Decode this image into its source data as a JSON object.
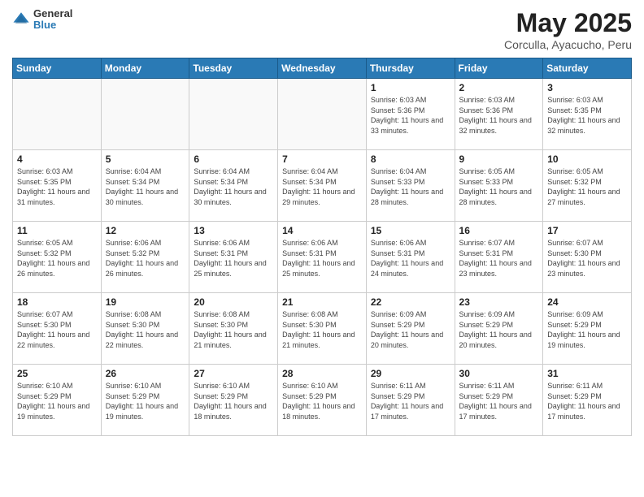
{
  "header": {
    "logo_line1": "General",
    "logo_line2": "Blue",
    "month_title": "May 2025",
    "subtitle": "Corculla, Ayacucho, Peru"
  },
  "weekdays": [
    "Sunday",
    "Monday",
    "Tuesday",
    "Wednesday",
    "Thursday",
    "Friday",
    "Saturday"
  ],
  "weeks": [
    [
      {
        "day": "",
        "info": ""
      },
      {
        "day": "",
        "info": ""
      },
      {
        "day": "",
        "info": ""
      },
      {
        "day": "",
        "info": ""
      },
      {
        "day": "1",
        "info": "Sunrise: 6:03 AM\nSunset: 5:36 PM\nDaylight: 11 hours and 33 minutes."
      },
      {
        "day": "2",
        "info": "Sunrise: 6:03 AM\nSunset: 5:36 PM\nDaylight: 11 hours and 32 minutes."
      },
      {
        "day": "3",
        "info": "Sunrise: 6:03 AM\nSunset: 5:35 PM\nDaylight: 11 hours and 32 minutes."
      }
    ],
    [
      {
        "day": "4",
        "info": "Sunrise: 6:03 AM\nSunset: 5:35 PM\nDaylight: 11 hours and 31 minutes."
      },
      {
        "day": "5",
        "info": "Sunrise: 6:04 AM\nSunset: 5:34 PM\nDaylight: 11 hours and 30 minutes."
      },
      {
        "day": "6",
        "info": "Sunrise: 6:04 AM\nSunset: 5:34 PM\nDaylight: 11 hours and 30 minutes."
      },
      {
        "day": "7",
        "info": "Sunrise: 6:04 AM\nSunset: 5:34 PM\nDaylight: 11 hours and 29 minutes."
      },
      {
        "day": "8",
        "info": "Sunrise: 6:04 AM\nSunset: 5:33 PM\nDaylight: 11 hours and 28 minutes."
      },
      {
        "day": "9",
        "info": "Sunrise: 6:05 AM\nSunset: 5:33 PM\nDaylight: 11 hours and 28 minutes."
      },
      {
        "day": "10",
        "info": "Sunrise: 6:05 AM\nSunset: 5:32 PM\nDaylight: 11 hours and 27 minutes."
      }
    ],
    [
      {
        "day": "11",
        "info": "Sunrise: 6:05 AM\nSunset: 5:32 PM\nDaylight: 11 hours and 26 minutes."
      },
      {
        "day": "12",
        "info": "Sunrise: 6:06 AM\nSunset: 5:32 PM\nDaylight: 11 hours and 26 minutes."
      },
      {
        "day": "13",
        "info": "Sunrise: 6:06 AM\nSunset: 5:31 PM\nDaylight: 11 hours and 25 minutes."
      },
      {
        "day": "14",
        "info": "Sunrise: 6:06 AM\nSunset: 5:31 PM\nDaylight: 11 hours and 25 minutes."
      },
      {
        "day": "15",
        "info": "Sunrise: 6:06 AM\nSunset: 5:31 PM\nDaylight: 11 hours and 24 minutes."
      },
      {
        "day": "16",
        "info": "Sunrise: 6:07 AM\nSunset: 5:31 PM\nDaylight: 11 hours and 23 minutes."
      },
      {
        "day": "17",
        "info": "Sunrise: 6:07 AM\nSunset: 5:30 PM\nDaylight: 11 hours and 23 minutes."
      }
    ],
    [
      {
        "day": "18",
        "info": "Sunrise: 6:07 AM\nSunset: 5:30 PM\nDaylight: 11 hours and 22 minutes."
      },
      {
        "day": "19",
        "info": "Sunrise: 6:08 AM\nSunset: 5:30 PM\nDaylight: 11 hours and 22 minutes."
      },
      {
        "day": "20",
        "info": "Sunrise: 6:08 AM\nSunset: 5:30 PM\nDaylight: 11 hours and 21 minutes."
      },
      {
        "day": "21",
        "info": "Sunrise: 6:08 AM\nSunset: 5:30 PM\nDaylight: 11 hours and 21 minutes."
      },
      {
        "day": "22",
        "info": "Sunrise: 6:09 AM\nSunset: 5:29 PM\nDaylight: 11 hours and 20 minutes."
      },
      {
        "day": "23",
        "info": "Sunrise: 6:09 AM\nSunset: 5:29 PM\nDaylight: 11 hours and 20 minutes."
      },
      {
        "day": "24",
        "info": "Sunrise: 6:09 AM\nSunset: 5:29 PM\nDaylight: 11 hours and 19 minutes."
      }
    ],
    [
      {
        "day": "25",
        "info": "Sunrise: 6:10 AM\nSunset: 5:29 PM\nDaylight: 11 hours and 19 minutes."
      },
      {
        "day": "26",
        "info": "Sunrise: 6:10 AM\nSunset: 5:29 PM\nDaylight: 11 hours and 19 minutes."
      },
      {
        "day": "27",
        "info": "Sunrise: 6:10 AM\nSunset: 5:29 PM\nDaylight: 11 hours and 18 minutes."
      },
      {
        "day": "28",
        "info": "Sunrise: 6:10 AM\nSunset: 5:29 PM\nDaylight: 11 hours and 18 minutes."
      },
      {
        "day": "29",
        "info": "Sunrise: 6:11 AM\nSunset: 5:29 PM\nDaylight: 11 hours and 17 minutes."
      },
      {
        "day": "30",
        "info": "Sunrise: 6:11 AM\nSunset: 5:29 PM\nDaylight: 11 hours and 17 minutes."
      },
      {
        "day": "31",
        "info": "Sunrise: 6:11 AM\nSunset: 5:29 PM\nDaylight: 11 hours and 17 minutes."
      }
    ]
  ]
}
